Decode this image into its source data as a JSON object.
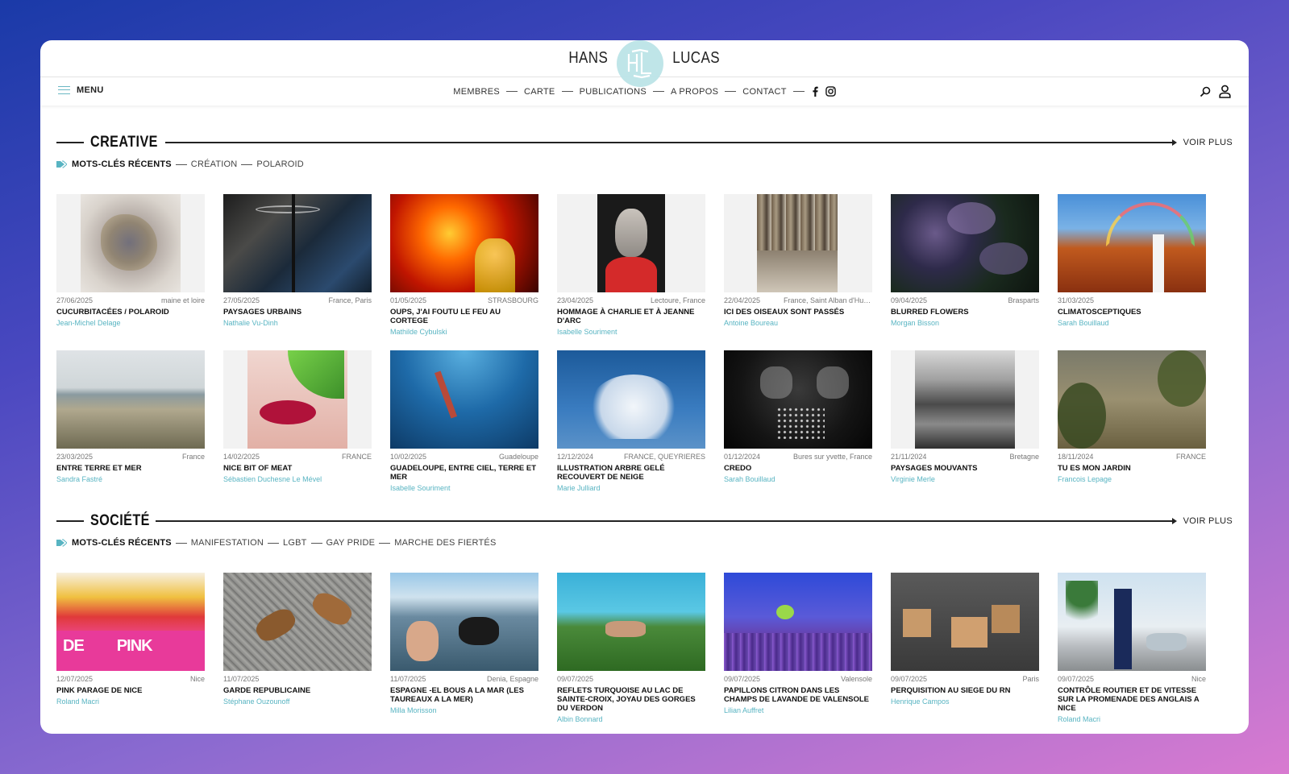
{
  "brand": {
    "left": "HANS",
    "right": "LUCAS"
  },
  "nav": {
    "menu_label": "MENU",
    "links": [
      "MEMBRES",
      "CARTE",
      "PUBLICATIONS",
      "A PROPOS",
      "CONTACT"
    ]
  },
  "colors": {
    "accent": "#58b4c2",
    "logo_bg": "#bfe5e8"
  },
  "sections": [
    {
      "title": "CREATIVE",
      "more": "VOIR PLUS",
      "recent_label": "MOTS-CLÉS RÉCENTS",
      "tags": [
        "CRÉATION",
        "POLAROID"
      ],
      "rows": [
        [
          {
            "date": "27/06/2025",
            "loc": "maine et loire",
            "title": "CUCURBITACÉES / POLAROID",
            "author": "Jean-Michel Delage"
          },
          {
            "date": "27/05/2025",
            "loc": "France, Paris",
            "title": "PAYSAGES URBAINS",
            "author": "Nathalie Vu-Dinh"
          },
          {
            "date": "01/05/2025",
            "loc": "STRASBOURG",
            "title": "OUPS, J'AI FOUTU LE FEU AU CORTEGE",
            "author": "Mathilde Cybulski"
          },
          {
            "date": "23/04/2025",
            "loc": "Lectoure, France",
            "title": "HOMMAGE À CHARLIE ET À JEANNE D'ARC",
            "author": "Isabelle Souriment"
          },
          {
            "date": "22/04/2025",
            "loc": "France, Saint Alban d'Hurtiè...",
            "title": "ICI DES OISEAUX SONT PASSÉS",
            "author": "Antoine Boureau"
          },
          {
            "date": "09/04/2025",
            "loc": "Brasparts",
            "title": "BLURRED FLOWERS",
            "author": "Morgan Bisson"
          },
          {
            "date": "31/03/2025",
            "loc": "",
            "title": "CLIMATOSCEPTIQUES",
            "author": "Sarah Bouillaud"
          }
        ],
        [
          {
            "date": "23/03/2025",
            "loc": "France",
            "title": "ENTRE TERRE ET MER",
            "author": "Sandra Fastré"
          },
          {
            "date": "14/02/2025",
            "loc": "FRANCE",
            "title": "NICE BIT OF MEAT",
            "author": "Sébastien Duchesne Le Mével"
          },
          {
            "date": "10/02/2025",
            "loc": "Guadeloupe",
            "title": "GUADELOUPE, ENTRE CIEL, TERRE ET MER",
            "author": "Isabelle Souriment"
          },
          {
            "date": "12/12/2024",
            "loc": "FRANCE, QUEYRIERES",
            "title": "ILLUSTRATION ARBRE GELÉ RECOUVERT DE NEIGE",
            "author": "Marie Julliard"
          },
          {
            "date": "01/12/2024",
            "loc": "Bures sur yvette, France",
            "title": "CREDO",
            "author": "Sarah Bouillaud"
          },
          {
            "date": "21/11/2024",
            "loc": "Bretagne",
            "title": "PAYSAGES MOUVANTS",
            "author": "Virginie Merle"
          },
          {
            "date": "18/11/2024",
            "loc": "FRANCE",
            "title": "TU ES MON JARDIN",
            "author": "Francois Lepage"
          }
        ]
      ]
    },
    {
      "title": "SOCIÉTÉ",
      "more": "VOIR PLUS",
      "recent_label": "MOTS-CLÉS RÉCENTS",
      "tags": [
        "MANIFESTATION",
        "LGBT",
        "GAY PRIDE",
        "MARCHE DES FIERTÉS"
      ],
      "rows": [
        [
          {
            "date": "12/07/2025",
            "loc": "Nice",
            "title": "PINK PARAGE DE NICE",
            "author": "Roland Macri"
          },
          {
            "date": "11/07/2025",
            "loc": "",
            "title": "GARDE REPUBLICAINE",
            "author": "Stéphane Ouzounoff"
          },
          {
            "date": "11/07/2025",
            "loc": "Denia, Espagne",
            "title": "ESPAGNE -EL BOUS A LA MAR (LES TAUREAUX A LA MER)",
            "author": "Milla Morisson"
          },
          {
            "date": "09/07/2025",
            "loc": "",
            "title": "REFLETS TURQUOISE AU LAC DE SAINTE-CROIX, JOYAU DES GORGES DU VERDON",
            "author": "Albin Bonnard"
          },
          {
            "date": "09/07/2025",
            "loc": "Valensole",
            "title": "PAPILLONS CITRON DANS LES CHAMPS DE LAVANDE DE VALENSOLE",
            "author": "Lilian Auffret"
          },
          {
            "date": "09/07/2025",
            "loc": "Paris",
            "title": "PERQUISITION AU SIEGE DU RN",
            "author": "Henrique Campos"
          },
          {
            "date": "09/07/2025",
            "loc": "Nice",
            "title": "CONTRÔLE ROUTIER ET DE VITESSE SUR LA PROMENADE DES ANGLAIS A NICE",
            "author": "Roland Macri"
          }
        ]
      ]
    }
  ]
}
